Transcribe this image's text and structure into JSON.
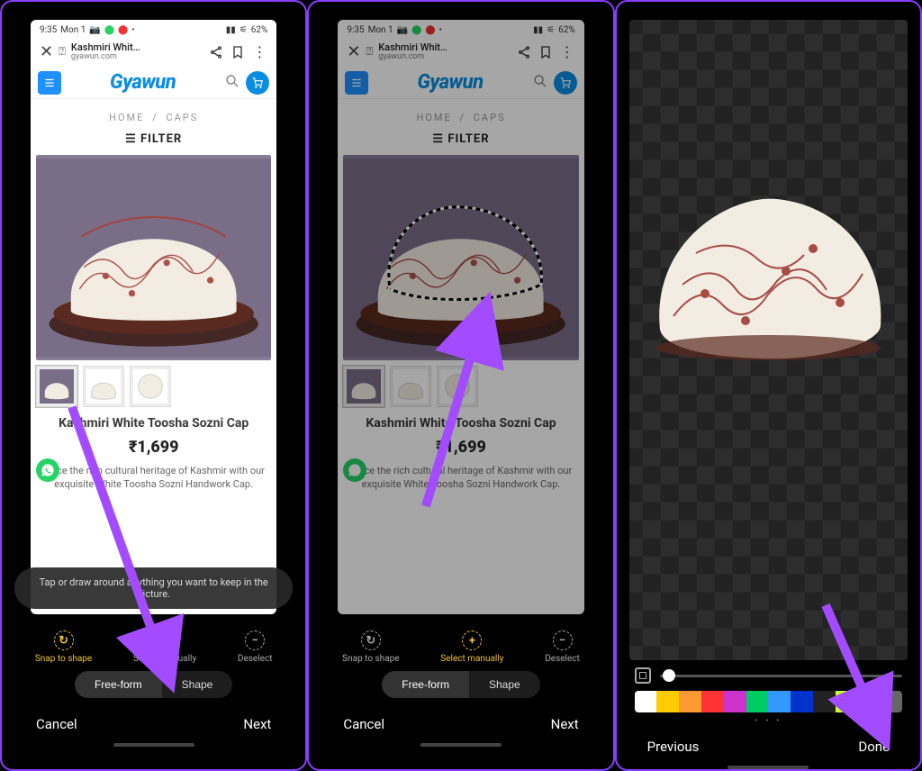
{
  "status_bar": {
    "time": "9:35",
    "day": "Mon 1",
    "battery": "62%",
    "signal_icon": "signal-icon",
    "wifi_icon": "wifi-icon"
  },
  "browser": {
    "page_title": "Kashmiri Whit…",
    "domain": "gyawun.com"
  },
  "site": {
    "logo": "Gyawun",
    "breadcrumb_home": "HOME",
    "breadcrumb_sep": "/",
    "breadcrumb_cat": "CAPS",
    "filter_label": "FILTER",
    "product_title": "Kashmiri White Toosha Sozni Cap",
    "price": "₹1,699",
    "desc_line_panel1": "brace the rich cultural heritage of Kashmir with our exquisite White Toosha Sozni Handwork Cap.",
    "desc_line_panel2": "brace the rich cultural heritage of Kashmir with our exquisite White Toosha Sozni Handwork Cap."
  },
  "editor": {
    "hint": "Tap or draw around anything you want to keep in the picture.",
    "tool_snap": "Snap to shape",
    "tool_select": "Select manually",
    "tool_deselect": "Deselect",
    "seg_freeform": "Free-form",
    "seg_shape": "Shape",
    "cancel": "Cancel",
    "next": "Next",
    "previous": "Previous",
    "done": "Done"
  },
  "palette": {
    "colors": [
      "#ffffff",
      "#ffcc00",
      "#ff9933",
      "#ff3333",
      "#cc33cc",
      "#00cc66",
      "#3399ff",
      "#0033cc",
      "#222222",
      "#ccff33",
      "#33cccc",
      "#666666"
    ]
  }
}
